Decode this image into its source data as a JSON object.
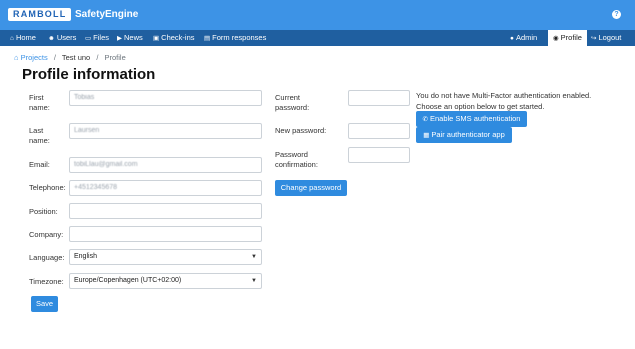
{
  "header": {
    "logo": "RAMBOLL",
    "brand": "SafetyEngine",
    "help_icon": "question-circle-icon"
  },
  "nav": {
    "home": "Home",
    "users": "Users",
    "files": "Files",
    "news": "News",
    "checkins": "Check-ins",
    "form_responses": "Form responses",
    "admin": "Admin",
    "profile": "Profile",
    "logout": "Logout"
  },
  "breadcrumb": {
    "projects": "Projects",
    "project": "Test uno",
    "current": "Profile"
  },
  "page": {
    "title": "Profile information"
  },
  "profile_form": {
    "first_name_label": "First name:",
    "first_name_value": "Tobias",
    "last_name_label": "Last name:",
    "last_name_value": "Laursen",
    "email_label": "Email:",
    "email_value": "tobiLlau@gmail.com",
    "telephone_label": "Telephone:",
    "telephone_value": "+4512345678",
    "position_label": "Position:",
    "position_value": "",
    "company_label": "Company:",
    "company_value": "",
    "language_label": "Language:",
    "language_value": "English",
    "timezone_label": "Timezone:",
    "timezone_value": "Europe/Copenhagen (UTC+02:00)",
    "save": "Save"
  },
  "password_form": {
    "current_label": "Current password:",
    "new_label": "New password:",
    "confirm_label": "Password confirmation:",
    "change": "Change password"
  },
  "mfa": {
    "notice_1": "You do not have Multi-Factor authentication enabled.",
    "notice_2": "Choose an option below to get started.",
    "sms": "Enable SMS authentication",
    "app": "Pair authenticator app"
  },
  "colors": {
    "topbar": "#3d93e6",
    "navbar": "#1f5fa0",
    "button": "#2f8bdf"
  }
}
